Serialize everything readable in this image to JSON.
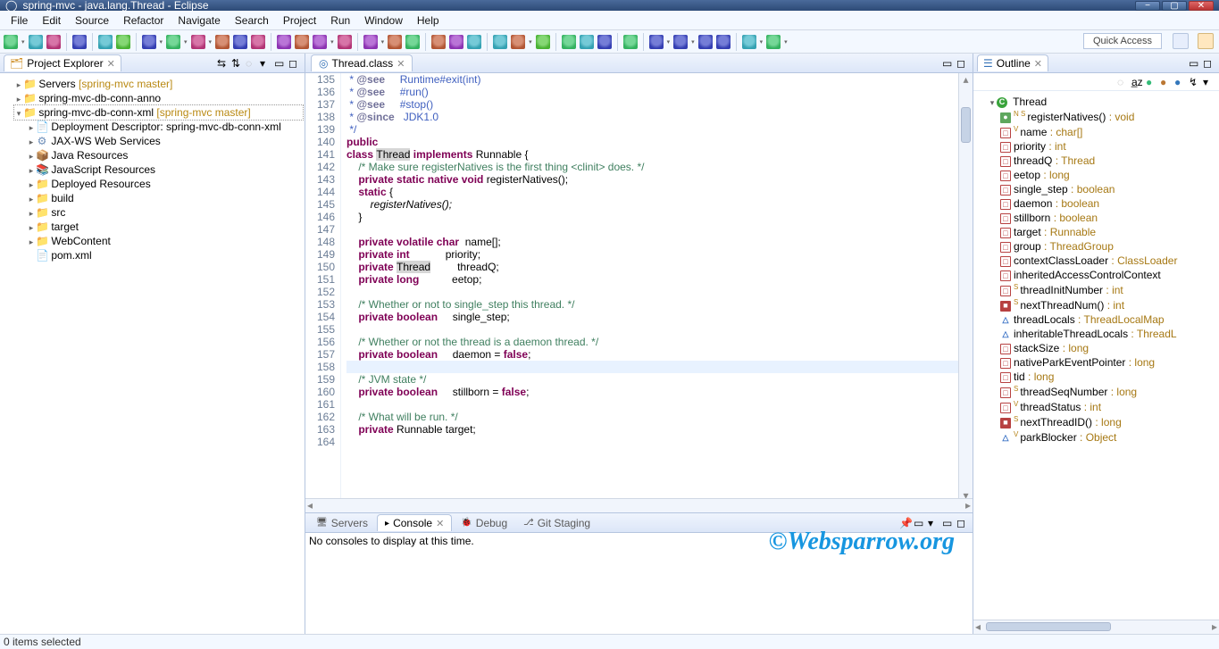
{
  "window": {
    "title": "spring-mvc - java.lang.Thread - Eclipse",
    "minimize_tip": "Minimize",
    "maximize_tip": "Maximize",
    "close_tip": "Close"
  },
  "menu": {
    "items": [
      "File",
      "Edit",
      "Source",
      "Refactor",
      "Navigate",
      "Search",
      "Project",
      "Run",
      "Window",
      "Help"
    ]
  },
  "quick_access": "Quick Access",
  "explorer": {
    "title": "Project Explorer",
    "items": [
      {
        "icon": "▸",
        "glyph": "📁",
        "label": "Servers",
        "suffix": "[spring-mvc master]",
        "suffixCls": "branch",
        "open": false
      },
      {
        "icon": "▸",
        "glyph": "📁",
        "label": "spring-mvc-db-conn-anno",
        "open": false
      },
      {
        "icon": "▾",
        "glyph": "📁",
        "label": "spring-mvc-db-conn-xml",
        "suffix": "[spring-mvc master]",
        "suffixCls": "branch",
        "open": true,
        "children": [
          {
            "icon": "▸",
            "glyph": "📄",
            "label": "Deployment Descriptor: spring-mvc-db-conn-xml"
          },
          {
            "icon": "▸",
            "glyph": "⚙",
            "label": "JAX-WS Web Services"
          },
          {
            "icon": "▸",
            "glyph": "📦",
            "label": "Java Resources"
          },
          {
            "icon": "▸",
            "glyph": "📚",
            "label": "JavaScript Resources"
          },
          {
            "icon": "▸",
            "glyph": "📁",
            "label": "Deployed Resources"
          },
          {
            "icon": "▸",
            "glyph": "📁",
            "label": "build"
          },
          {
            "icon": "▸",
            "glyph": "📁",
            "label": "src"
          },
          {
            "icon": "▸",
            "glyph": "📁",
            "label": "target"
          },
          {
            "icon": "▸",
            "glyph": "📁",
            "label": "WebContent"
          },
          {
            "icon": "",
            "glyph": "📄",
            "label": "pom.xml"
          }
        ]
      }
    ]
  },
  "editor": {
    "tab": "Thread.class",
    "lines": [
      {
        "n": 135,
        "seg": [
          {
            "t": " * ",
            "c": "jd"
          },
          {
            "t": "@see",
            "c": "tag"
          },
          {
            "t": "     Runtime#exit(int)",
            "c": "jd"
          }
        ]
      },
      {
        "n": 136,
        "seg": [
          {
            "t": " * ",
            "c": "jd"
          },
          {
            "t": "@see",
            "c": "tag"
          },
          {
            "t": "     #run()",
            "c": "jd"
          }
        ]
      },
      {
        "n": 137,
        "seg": [
          {
            "t": " * ",
            "c": "jd"
          },
          {
            "t": "@see",
            "c": "tag"
          },
          {
            "t": "     #stop()",
            "c": "jd"
          }
        ]
      },
      {
        "n": 138,
        "seg": [
          {
            "t": " * ",
            "c": "jd"
          },
          {
            "t": "@since",
            "c": "tag"
          },
          {
            "t": "   JDK1.0",
            "c": "jd"
          }
        ]
      },
      {
        "n": 139,
        "seg": [
          {
            "t": " */",
            "c": "jd"
          }
        ]
      },
      {
        "n": 140,
        "seg": [
          {
            "t": "public",
            "c": "kw"
          }
        ]
      },
      {
        "n": 141,
        "seg": [
          {
            "t": "class ",
            "c": "kw"
          },
          {
            "t": "Thread",
            "c": "sel"
          },
          {
            "t": " implements ",
            "c": "kw"
          },
          {
            "t": "Runnable {"
          }
        ]
      },
      {
        "n": 142,
        "seg": [
          {
            "t": "    /* Make sure registerNatives is the first thing <clinit> does. */",
            "c": "cm"
          }
        ]
      },
      {
        "n": 143,
        "seg": [
          {
            "t": "    private static native void ",
            "c": "kw"
          },
          {
            "t": "registerNatives();"
          }
        ]
      },
      {
        "n": 144,
        "seg": [
          {
            "t": "    static ",
            "c": "kw"
          },
          {
            "t": "{"
          }
        ]
      },
      {
        "n": 145,
        "seg": [
          {
            "t": "        registerNatives();",
            "s": "font-style:italic"
          }
        ]
      },
      {
        "n": 146,
        "seg": [
          {
            "t": "    }"
          }
        ]
      },
      {
        "n": 147,
        "seg": [
          {
            "t": ""
          }
        ]
      },
      {
        "n": 148,
        "seg": [
          {
            "t": "    private volatile char  ",
            "c": "kw"
          },
          {
            "t": "name[];"
          }
        ]
      },
      {
        "n": 149,
        "seg": [
          {
            "t": "    private int",
            "c": "kw"
          },
          {
            "t": "            priority;"
          }
        ]
      },
      {
        "n": 150,
        "seg": [
          {
            "t": "    private ",
            "c": "kw"
          },
          {
            "t": "Thread",
            "c": "sel"
          },
          {
            "t": "         threadQ;"
          }
        ]
      },
      {
        "n": 151,
        "seg": [
          {
            "t": "    private long",
            "c": "kw"
          },
          {
            "t": "           eetop;"
          }
        ]
      },
      {
        "n": 152,
        "seg": [
          {
            "t": ""
          }
        ]
      },
      {
        "n": 153,
        "seg": [
          {
            "t": "    /* Whether or not to single_step this thread. */",
            "c": "cm"
          }
        ]
      },
      {
        "n": 154,
        "seg": [
          {
            "t": "    private boolean",
            "c": "kw"
          },
          {
            "t": "     single_step;"
          }
        ]
      },
      {
        "n": 155,
        "seg": [
          {
            "t": ""
          }
        ]
      },
      {
        "n": 156,
        "seg": [
          {
            "t": "    /* Whether or not the thread is a daemon thread. */",
            "c": "cm"
          }
        ]
      },
      {
        "n": 157,
        "seg": [
          {
            "t": "    private boolean",
            "c": "kw"
          },
          {
            "t": "     daemon = "
          },
          {
            "t": "false",
            "c": "kw"
          },
          {
            "t": ";"
          }
        ]
      },
      {
        "n": 158,
        "seg": [
          {
            "t": ""
          }
        ],
        "cur": true
      },
      {
        "n": 159,
        "seg": [
          {
            "t": "    /* JVM state */",
            "c": "cm"
          }
        ]
      },
      {
        "n": 160,
        "seg": [
          {
            "t": "    private boolean",
            "c": "kw"
          },
          {
            "t": "     stillborn = "
          },
          {
            "t": "false",
            "c": "kw"
          },
          {
            "t": ";"
          }
        ]
      },
      {
        "n": 161,
        "seg": [
          {
            "t": ""
          }
        ]
      },
      {
        "n": 162,
        "seg": [
          {
            "t": "    /* What will be run. */",
            "c": "cm"
          }
        ]
      },
      {
        "n": 163,
        "seg": [
          {
            "t": "    private ",
            "c": "kw"
          },
          {
            "t": "Runnable target;"
          }
        ]
      },
      {
        "n": 164,
        "seg": [
          {
            "t": ""
          }
        ]
      }
    ]
  },
  "outline": {
    "title": "Outline",
    "root": "Thread",
    "items": [
      {
        "k": "mth",
        "sup": "N S",
        "n": "registerNatives()",
        "t": "void"
      },
      {
        "k": "fld",
        "sup": "V",
        "n": "name",
        "t": "char[]"
      },
      {
        "k": "fld",
        "n": "priority",
        "t": "int"
      },
      {
        "k": "fld",
        "n": "threadQ",
        "t": "Thread"
      },
      {
        "k": "fld",
        "n": "eetop",
        "t": "long"
      },
      {
        "k": "fld",
        "n": "single_step",
        "t": "boolean"
      },
      {
        "k": "fld",
        "n": "daemon",
        "t": "boolean"
      },
      {
        "k": "fld",
        "n": "stillborn",
        "t": "boolean"
      },
      {
        "k": "fld",
        "n": "target",
        "t": "Runnable"
      },
      {
        "k": "fld",
        "n": "group",
        "t": "ThreadGroup"
      },
      {
        "k": "fld",
        "n": "contextClassLoader",
        "t": "ClassLoader"
      },
      {
        "k": "fld",
        "n": "inheritedAccessControlContext",
        "t": ""
      },
      {
        "k": "fld",
        "sup": "S",
        "n": "threadInitNumber",
        "t": "int"
      },
      {
        "k": "mth",
        "sup": "S",
        "n": "nextThreadNum()",
        "t": "int",
        "box": true
      },
      {
        "k": "tri",
        "n": "threadLocals",
        "t": "ThreadLocalMap"
      },
      {
        "k": "tri",
        "n": "inheritableThreadLocals",
        "t": "ThreadL"
      },
      {
        "k": "fld",
        "n": "stackSize",
        "t": "long"
      },
      {
        "k": "fld",
        "n": "nativeParkEventPointer",
        "t": "long"
      },
      {
        "k": "fld",
        "n": "tid",
        "t": "long"
      },
      {
        "k": "fld",
        "sup": "S",
        "n": "threadSeqNumber",
        "t": "long"
      },
      {
        "k": "fld",
        "sup": "V",
        "n": "threadStatus",
        "t": "int"
      },
      {
        "k": "mth",
        "sup": "S",
        "n": "nextThreadID()",
        "t": "long",
        "box": true
      },
      {
        "k": "tri",
        "sup": "V",
        "n": "parkBlocker",
        "t": "Object"
      }
    ]
  },
  "console": {
    "tabs": [
      "Servers",
      "Console",
      "Debug",
      "Git Staging"
    ],
    "active": 1,
    "message": "No consoles to display at this time."
  },
  "watermark": "©Websparrow.org",
  "status": "0 items selected"
}
